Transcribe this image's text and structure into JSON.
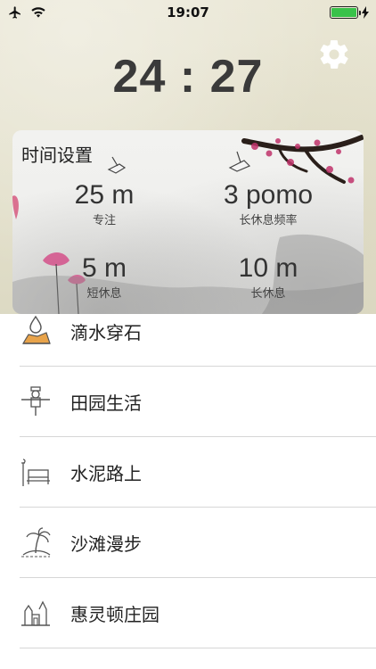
{
  "status_bar": {
    "time": "19:07",
    "icons": [
      "airplane-icon",
      "wifi-icon",
      "battery-icon",
      "charging-bolt-icon"
    ],
    "battery_level": 1.0,
    "battery_color": "#39c24a"
  },
  "timer": {
    "display": "24 : 27"
  },
  "settings": {
    "title": "时间设置",
    "focus": {
      "value": "25 m",
      "label": "专注"
    },
    "long_break_frequency": {
      "value": "3 pomo",
      "label": "长休息频率"
    },
    "short_break": {
      "value": "5 m",
      "label": "短休息"
    },
    "long_break": {
      "value": "10 m",
      "label": "长休息"
    }
  },
  "scenes": [
    {
      "label": "滴水穿石",
      "icon": "water-drop-stone-icon"
    },
    {
      "label": "田园生活",
      "icon": "scarecrow-icon"
    },
    {
      "label": "水泥路上",
      "icon": "bench-lamp-icon"
    },
    {
      "label": "沙滩漫步",
      "icon": "palm-island-icon"
    },
    {
      "label": "惠灵顿庄园",
      "icon": "castle-icon"
    }
  ],
  "colors": {
    "background_paper": "#e6e3cf",
    "timer_text": "#3a3a3a",
    "list_divider": "#d6d6d6"
  }
}
